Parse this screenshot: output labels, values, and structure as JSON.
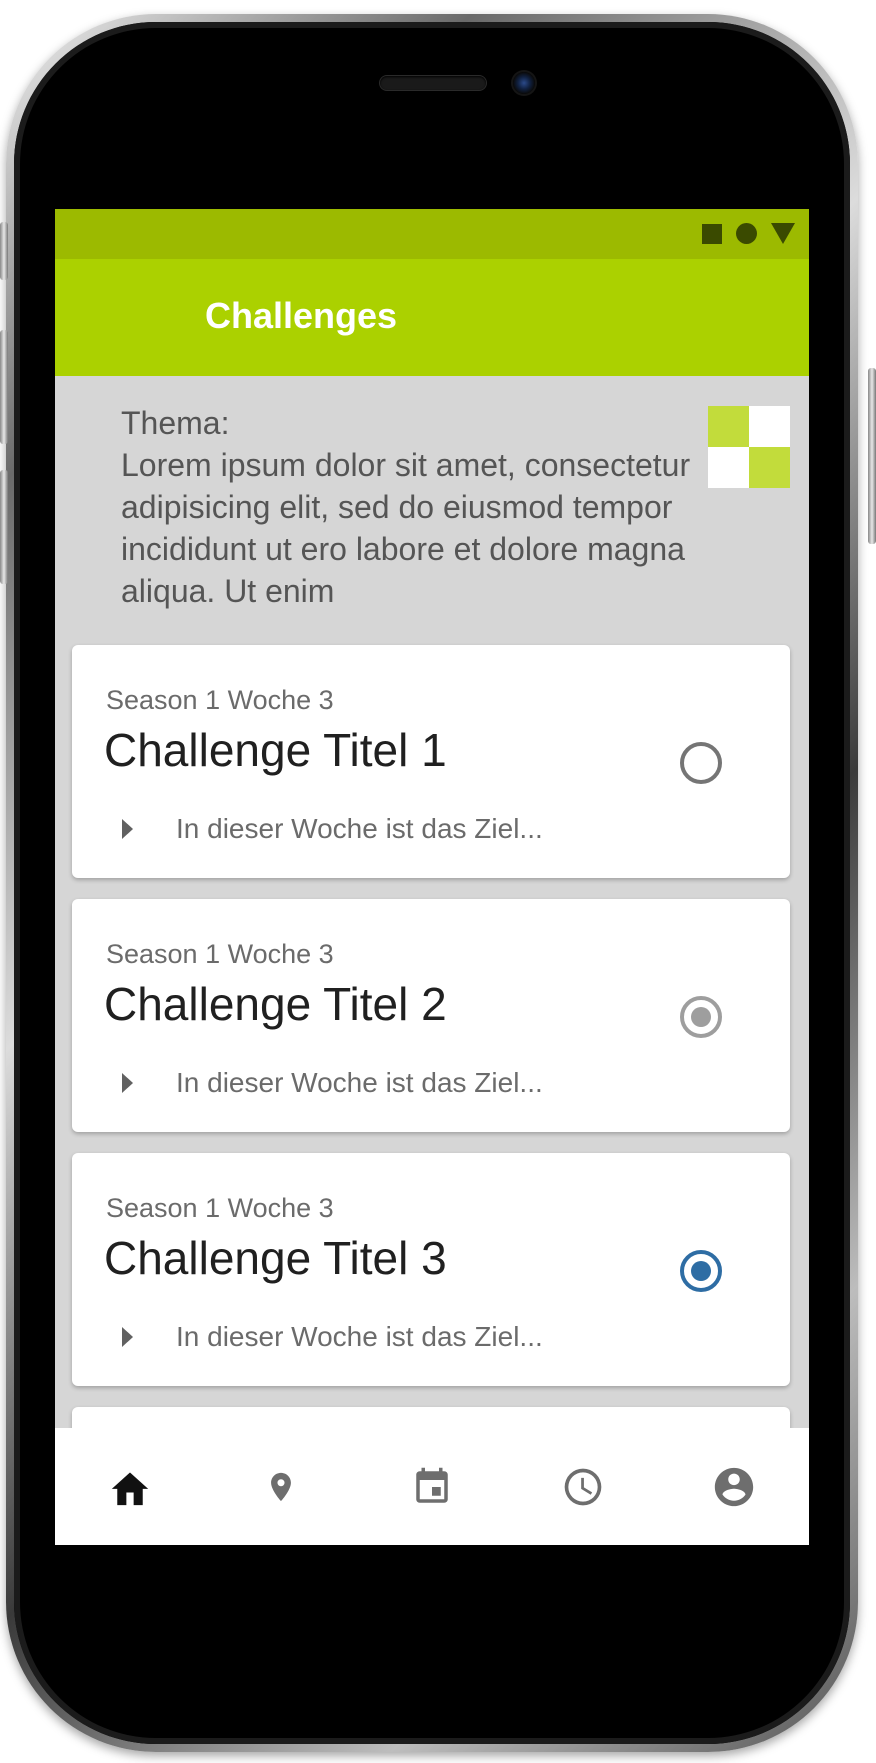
{
  "status_bar": {
    "icons": [
      "square-icon",
      "circle-icon",
      "triangle-icon"
    ],
    "color": "#9cba00"
  },
  "app_bar": {
    "title": "Challenges",
    "color": "#abd100"
  },
  "theme": {
    "text": "Thema:\nLorem ipsum dolor sit amet, consectetur adipisicing elit, sed do eiusmod tempor incididunt ut ero labore et dolore magna aliqua. Ut enim",
    "logo_colors": [
      "#c2dc3b",
      "#ffffff",
      "#ffffff",
      "#c2dc3b"
    ]
  },
  "challenges": [
    {
      "subtitle": "Season 1 Woche 3",
      "title": "Challenge Titel 1",
      "description": "In dieser Woche ist das Ziel...",
      "state": "unselected"
    },
    {
      "subtitle": "Season 1 Woche 3",
      "title": "Challenge Titel 2",
      "description": "In dieser Woche ist das Ziel...",
      "state": "disabled-selected"
    },
    {
      "subtitle": "Season 1 Woche 3",
      "title": "Challenge Titel 3",
      "description": "In dieser Woche ist das Ziel...",
      "state": "selected"
    }
  ],
  "bottom_nav": {
    "items": [
      {
        "icon": "home-icon",
        "active": true
      },
      {
        "icon": "location-pin-icon",
        "active": false
      },
      {
        "icon": "calendar-icon",
        "active": false
      },
      {
        "icon": "clock-icon",
        "active": false
      },
      {
        "icon": "account-icon",
        "active": false
      }
    ],
    "active_color": "#111111",
    "inactive_color": "#6e6e6e"
  },
  "colors": {
    "radio_selected": "#2e6da4",
    "radio_disabled": "#9e9e9e",
    "radio_unselected": "#757575"
  }
}
